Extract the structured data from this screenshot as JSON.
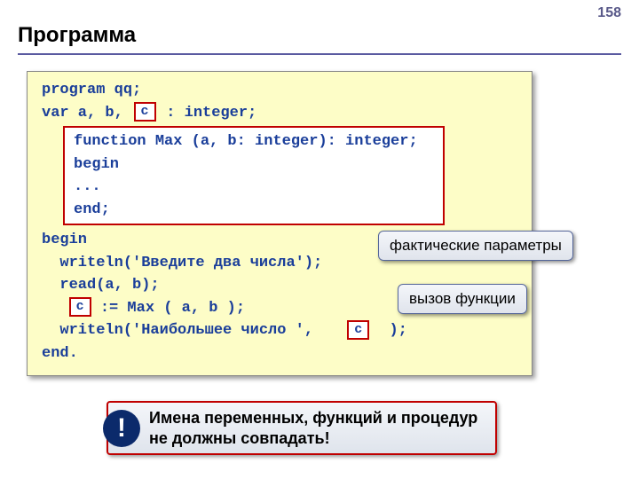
{
  "page_number": "158",
  "title": "Программа",
  "code": {
    "line1": "program qq;",
    "line2a": "var a, b, ",
    "line2b": " : integer;",
    "fn_line1": "function Max (a, b: integer): integer;",
    "fn_line2": "begin",
    "fn_line3": " ...",
    "fn_line4": "end;",
    "line3": "begin",
    "line4": "  writeln('Введите два числа');",
    "line5": "  read(a, b);",
    "line6a": "   ",
    "line6b": " := Max ( a, b );",
    "line7a": "  writeln('Наибольшее число ', ",
    "line7b": " );",
    "line8": "end."
  },
  "c_label": "c",
  "callouts": {
    "params": "фактические параметры",
    "call": "вызов функции"
  },
  "note": {
    "icon": "!",
    "text": "Имена переменных, функций и процедур не должны совпадать!"
  }
}
